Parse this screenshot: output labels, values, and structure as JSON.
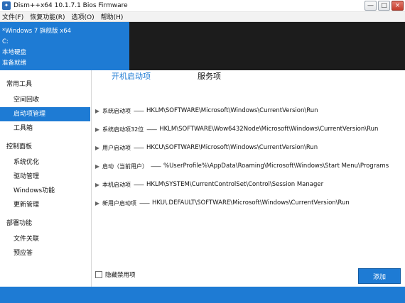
{
  "window": {
    "title": "Dism++x64 10.1.7.1 Bios Firmware",
    "app_icon": "app-logo-icon",
    "controls": {
      "minimize": "—",
      "maximize": "□",
      "close": "×"
    }
  },
  "menu": [
    "文件(F)",
    "恢复功能(R)",
    "选项(O)",
    "帮助(H)"
  ],
  "info": {
    "os": "*Windows 7 旗舰版 x64",
    "drive": "C:",
    "disk": "本地硬盘",
    "status": "准备就绪"
  },
  "sidebar": {
    "groups": [
      {
        "header": "常用工具",
        "items": [
          "空间回收",
          "启动项管理",
          "工具箱"
        ]
      },
      {
        "header": "控制面板",
        "items": [
          "系统优化",
          "驱动管理",
          "Windows功能",
          "更新管理"
        ]
      },
      {
        "header": "部署功能",
        "items": [
          "文件关联",
          "预应答"
        ]
      }
    ],
    "active_item": "启动项管理"
  },
  "tabs": {
    "startup": "开机启动项",
    "service": "服务项"
  },
  "entries": [
    {
      "name": "系统启动项",
      "sep": "——",
      "path": "HKLM\\SOFTWARE\\Microsoft\\Windows\\CurrentVersion\\Run"
    },
    {
      "name": "系统启动项32位",
      "sep": "——",
      "path": "HKLM\\SOFTWARE\\Wow6432Node\\Microsoft\\Windows\\CurrentVersion\\Run"
    },
    {
      "name": "用户启动项",
      "sep": "——",
      "path": "HKCU\\SOFTWARE\\Microsoft\\Windows\\CurrentVersion\\Run"
    },
    {
      "name": "启动（当前用户）",
      "sep": "——",
      "path": "%UserProfile%\\AppData\\Roaming\\Microsoft\\Windows\\Start Menu\\Programs"
    },
    {
      "name": "本机启动项",
      "sep": "——",
      "path": "HKLM\\SYSTEM\\CurrentControlSet\\Control\\Session Manager"
    },
    {
      "name": "新用户启动项",
      "sep": "——",
      "path": "HKU\\.DEFAULT\\SOFTWARE\\Microsoft\\Windows\\CurrentVersion\\Run"
    }
  ],
  "footer": {
    "hide_disabled_label": "隐藏禁用项",
    "add_button": "添加"
  },
  "colors": {
    "accent": "#1e7bd4",
    "dark_panel": "#1c1c1c"
  }
}
